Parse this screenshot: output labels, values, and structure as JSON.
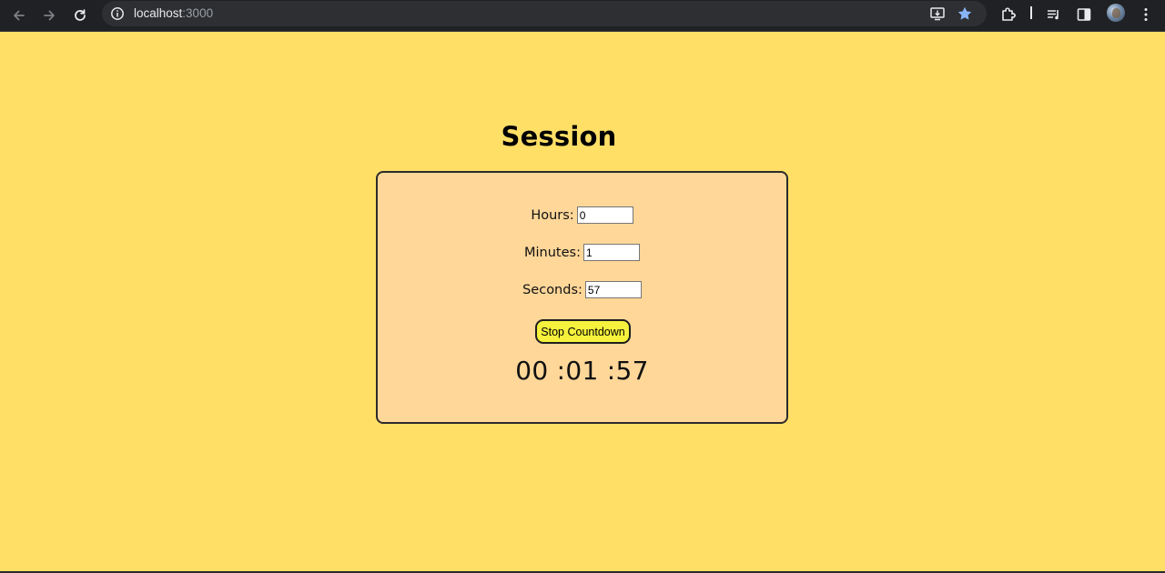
{
  "browser": {
    "url_host": "localhost",
    "url_port": ":3000"
  },
  "page": {
    "title": "Session"
  },
  "form": {
    "hours_label": "Hours:",
    "hours_value": "0",
    "minutes_label": "Minutes:",
    "minutes_value": "1",
    "seconds_label": "Seconds:",
    "seconds_value": "57",
    "stop_button_label": "Stop Countdown"
  },
  "timer": {
    "display": "00 :01 :57"
  },
  "colors": {
    "page_background": "#ffdf66",
    "card_background": "#ffd799",
    "button_background": "#f5f13d",
    "browser_chrome": "#202124",
    "bookmark_star": "#8ab4f8"
  },
  "icons": {
    "browser_toolbar": [
      "back-arrow-icon",
      "forward-arrow-icon",
      "reload-icon",
      "site-info-icon",
      "install-app-icon",
      "bookmark-star-icon",
      "extensions-puzzle-icon",
      "media-queue-icon",
      "side-panel-icon",
      "profile-avatar",
      "more-menu-icon"
    ]
  }
}
